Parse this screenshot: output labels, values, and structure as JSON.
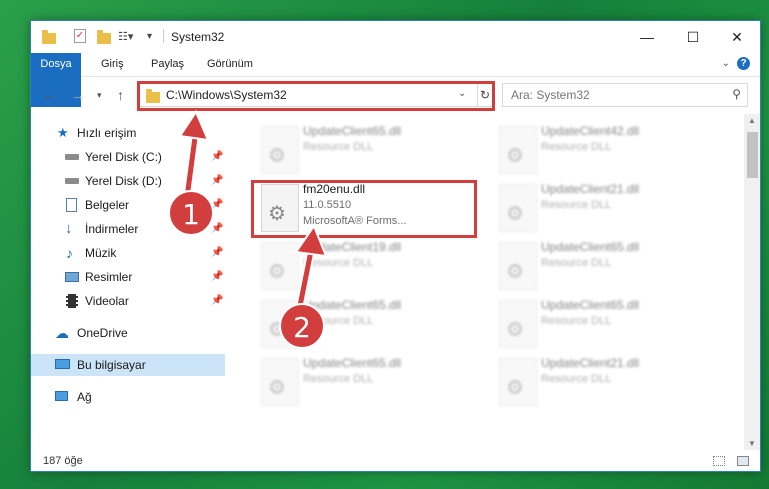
{
  "window": {
    "title": "System32",
    "controls": {
      "minimize": "—",
      "maximize": "☐",
      "close": "✕"
    }
  },
  "ribbon": {
    "tabs": [
      "Dosya",
      "Giriş",
      "Paylaş",
      "Görünüm"
    ],
    "help": "?"
  },
  "navigation": {
    "address": "C:\\Windows\\System32",
    "search_placeholder": "Ara: System32"
  },
  "sidebar": {
    "items": [
      {
        "label": "Hızlı erişim",
        "icon": "star-icon"
      },
      {
        "label": "Yerel Disk (C:)",
        "icon": "drive-icon",
        "pinned": true
      },
      {
        "label": "Yerel Disk (D:)",
        "icon": "drive-icon",
        "pinned": true
      },
      {
        "label": "Belgeler",
        "icon": "documents-icon",
        "pinned": true
      },
      {
        "label": "İndirmeler",
        "icon": "download-icon",
        "pinned": true
      },
      {
        "label": "Müzik",
        "icon": "music-icon",
        "pinned": true
      },
      {
        "label": "Resimler",
        "icon": "pictures-icon",
        "pinned": true
      },
      {
        "label": "Videolar",
        "icon": "videos-icon",
        "pinned": true
      },
      {
        "label": "OneDrive",
        "icon": "cloud-icon"
      },
      {
        "label": "Bu bilgisayar",
        "icon": "computer-icon",
        "selected": true
      },
      {
        "label": "Ağ",
        "icon": "network-icon"
      }
    ]
  },
  "files": {
    "left": [
      {
        "name": "UpdateClient65.dll",
        "desc": "Resource DLL"
      },
      {
        "name": "fm20enu.dll",
        "version": "11.0.5510",
        "company": "MicrosoftA® Forms...",
        "highlighted": true
      },
      {
        "name": "UpdateClient19.dll",
        "desc": "Resource DLL"
      },
      {
        "name": "UpdateClient65.dll",
        "desc": "Resource DLL"
      },
      {
        "name": "UpdateClient65.dll",
        "desc": "Resource DLL"
      }
    ],
    "right": [
      {
        "name": "UpdateClient42.dll",
        "desc": "Resource DLL"
      },
      {
        "name": "UpdateClient21.dll",
        "desc": "Resource DLL"
      },
      {
        "name": "UpdateClient65.dll",
        "desc": "Resource DLL"
      },
      {
        "name": "UpdateClient65.dll",
        "desc": "Resource DLL"
      },
      {
        "name": "UpdateClient21.dll",
        "desc": "Resource DLL"
      }
    ]
  },
  "status": {
    "count": "187 öğe"
  },
  "annotations": {
    "badge1": "1",
    "badge2": "2",
    "color": "#d23d3d"
  },
  "colors": {
    "accent": "#1a6dc0",
    "selected": "#cce4f7",
    "background": "#1d8f3a"
  }
}
